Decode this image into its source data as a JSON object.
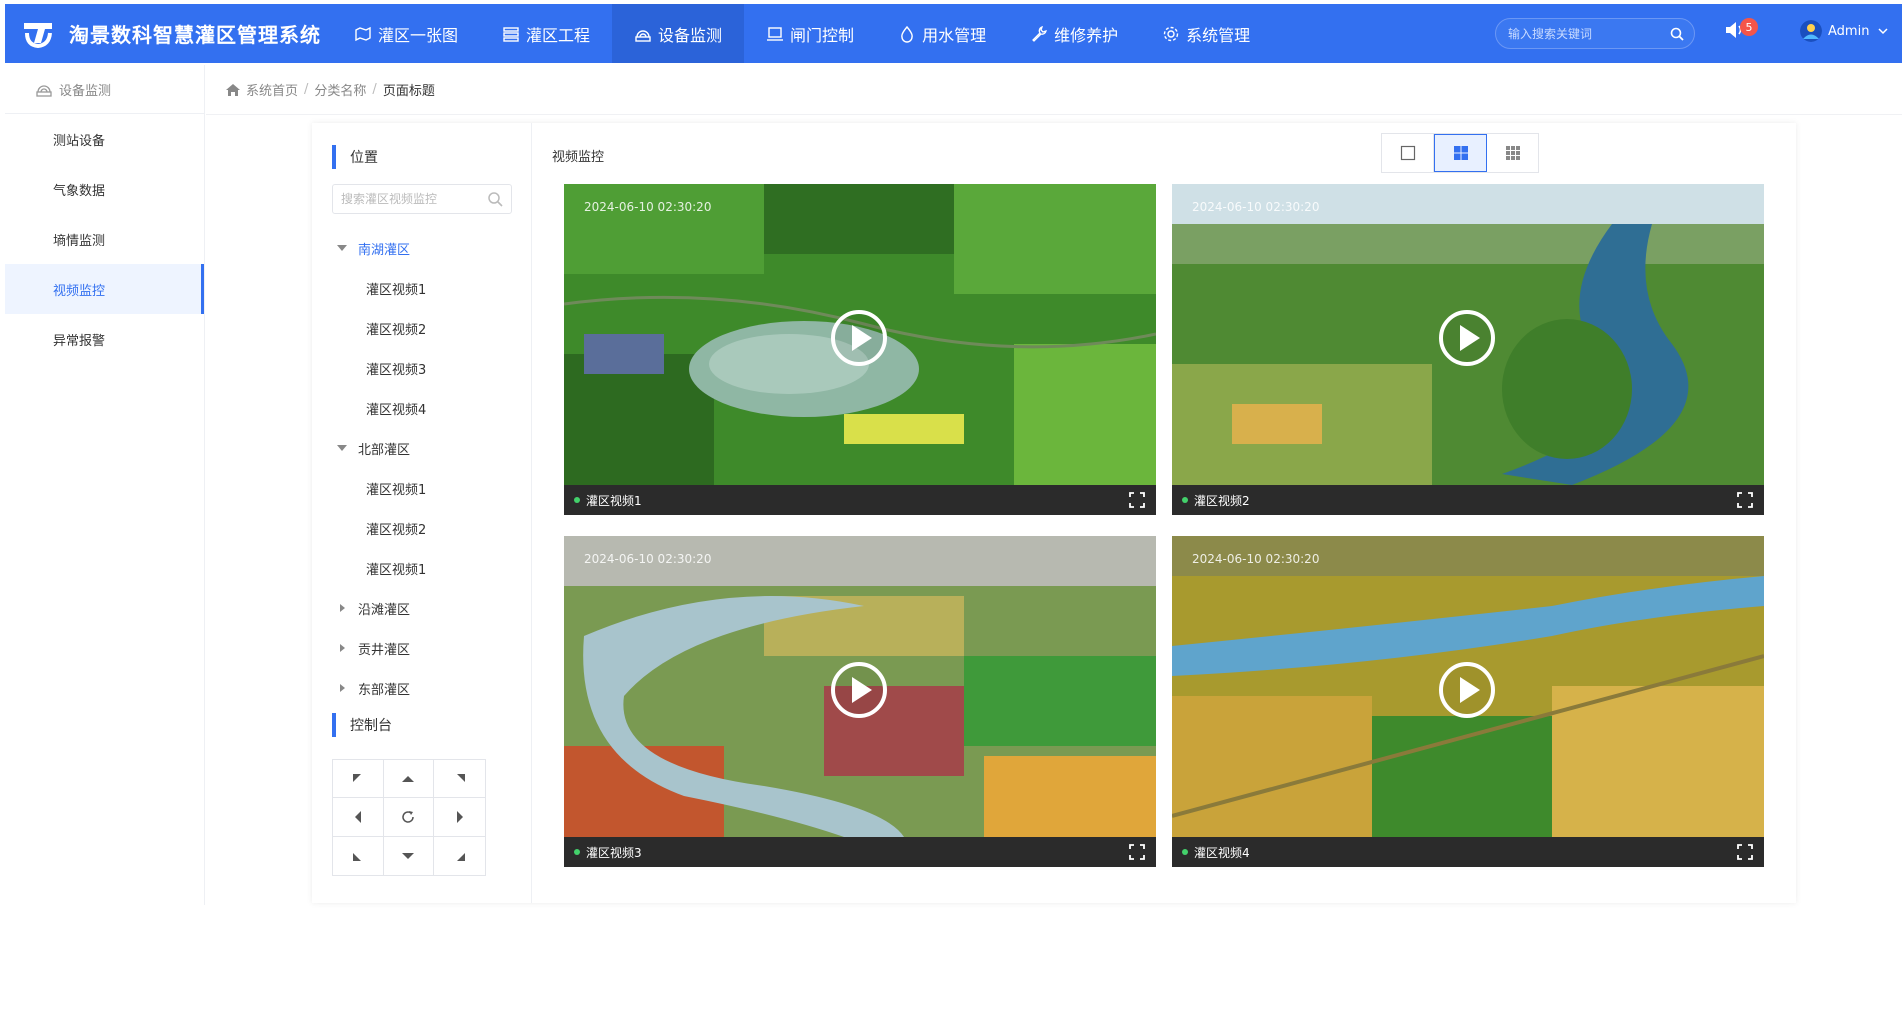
{
  "app": {
    "title": "淘景数科智慧灌区管理系统"
  },
  "nav": [
    {
      "label": "灌区一张图",
      "icon": "map-icon",
      "active": false
    },
    {
      "label": "灌区工程",
      "icon": "layers-icon",
      "active": false
    },
    {
      "label": "设备监测",
      "icon": "monitor-icon",
      "active": true
    },
    {
      "label": "闸门控制",
      "icon": "gate-icon",
      "active": false
    },
    {
      "label": "用水管理",
      "icon": "water-icon",
      "active": false
    },
    {
      "label": "维修养护",
      "icon": "wrench-icon",
      "active": false
    },
    {
      "label": "系统管理",
      "icon": "gear-icon",
      "active": false
    }
  ],
  "search": {
    "placeholder": "输入搜索关键词"
  },
  "notifications": {
    "count": "5"
  },
  "user": {
    "name": "Admin"
  },
  "sidebar": {
    "header": "设备监测",
    "items": [
      {
        "label": "测站设备",
        "active": false
      },
      {
        "label": "气象数据",
        "active": false
      },
      {
        "label": "墒情监测",
        "active": false
      },
      {
        "label": "视频监控",
        "active": true
      },
      {
        "label": "异常报警",
        "active": false
      }
    ]
  },
  "breadcrumb": {
    "home": "系统首页",
    "category": "分类名称",
    "page": "页面标题"
  },
  "tree_panel": {
    "title": "位置",
    "search_placeholder": "搜索灌区视频监控",
    "groups": [
      {
        "label": "南湖灌区",
        "expanded": true,
        "active": true,
        "children": [
          "灌区视频1",
          "灌区视频2",
          "灌区视频3",
          "灌区视频4"
        ]
      },
      {
        "label": "北部灌区",
        "expanded": true,
        "active": false,
        "children": [
          "灌区视频1",
          "灌区视频2",
          "灌区视频1"
        ]
      },
      {
        "label": "沿滩灌区",
        "expanded": false,
        "active": false,
        "children": []
      },
      {
        "label": "贡井灌区",
        "expanded": false,
        "active": false,
        "children": []
      },
      {
        "label": "东部灌区",
        "expanded": false,
        "active": false,
        "children": []
      }
    ],
    "control_title": "控制台"
  },
  "video_panel": {
    "title": "视频监控",
    "layout_options": [
      "single",
      "four",
      "nine"
    ],
    "active_layout": "four",
    "videos": [
      {
        "name": "灌区视频1",
        "timestamp": "2024-06-10 02:30:20"
      },
      {
        "name": "灌区视频2",
        "timestamp": "2024-06-10 02:30:20"
      },
      {
        "name": "灌区视频3",
        "timestamp": "2024-06-10 02:30:20"
      },
      {
        "name": "灌区视频4",
        "timestamp": "2024-06-10 02:30:20"
      }
    ]
  },
  "colors": {
    "primary": "#3370f0",
    "status_online": "#43d16b",
    "badge": "#f4554a"
  }
}
